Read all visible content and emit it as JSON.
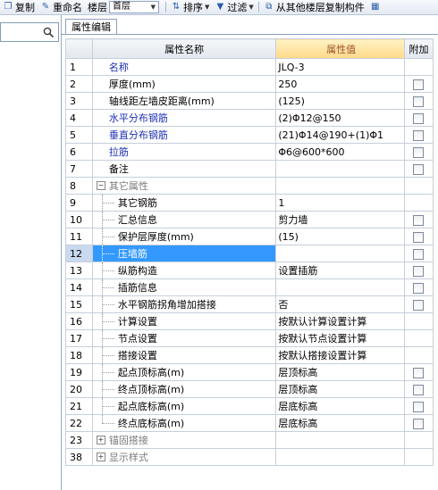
{
  "toolbar": {
    "copy_label": "复制",
    "rename_label": "重命名",
    "floor_label": "楼层",
    "floor_value": "首层",
    "sort_label": "排序",
    "filter_label": "过滤",
    "copy_from_floor_label": "从其他楼层复制构件"
  },
  "tab": {
    "label": "属性编辑"
  },
  "grid": {
    "header": {
      "name": "属性名称",
      "value": "属性值",
      "extra": "附加"
    },
    "rows": [
      {
        "num": "1",
        "name": "名称",
        "value": "JLQ-3",
        "style": "blue",
        "indent": 0,
        "check": false
      },
      {
        "num": "2",
        "name": "厚度(mm)",
        "value": "250",
        "style": "plain",
        "indent": 0,
        "check": true
      },
      {
        "num": "3",
        "name": "轴线距左墙皮距离(mm)",
        "value": "(125)",
        "style": "plain",
        "indent": 0,
        "check": true
      },
      {
        "num": "4",
        "name": "水平分布钢筋",
        "value": "(2)Φ12@150",
        "style": "blue",
        "indent": 0,
        "check": true
      },
      {
        "num": "5",
        "name": "垂直分布钢筋",
        "value": "(21)Φ14@190+(1)Φ1",
        "style": "blue",
        "indent": 0,
        "check": true
      },
      {
        "num": "6",
        "name": "拉筋",
        "value": "Φ6@600*600",
        "style": "blue",
        "indent": 0,
        "check": true
      },
      {
        "num": "7",
        "name": "备注",
        "value": "",
        "style": "plain",
        "indent": 0,
        "check": true
      },
      {
        "num": "8",
        "name": "其它属性",
        "value": "",
        "style": "group-open",
        "indent": 0,
        "check": false
      },
      {
        "num": "9",
        "name": "其它钢筋",
        "value": "1",
        "style": "child",
        "indent": 1,
        "check": false
      },
      {
        "num": "10",
        "name": "汇总信息",
        "value": "剪力墙",
        "style": "child",
        "indent": 1,
        "check": true
      },
      {
        "num": "11",
        "name": "保护层厚度(mm)",
        "value": "(15)",
        "style": "child",
        "indent": 1,
        "check": true
      },
      {
        "num": "12",
        "name": "压墙筋",
        "value": "",
        "style": "child-selected",
        "indent": 1,
        "check": true
      },
      {
        "num": "13",
        "name": "纵筋构造",
        "value": "设置插筋",
        "style": "child",
        "indent": 1,
        "check": true
      },
      {
        "num": "14",
        "name": "插筋信息",
        "value": "",
        "style": "child",
        "indent": 1,
        "check": true
      },
      {
        "num": "15",
        "name": "水平钢筋拐角增加搭接",
        "value": "否",
        "style": "child",
        "indent": 1,
        "check": true
      },
      {
        "num": "16",
        "name": "计算设置",
        "value": "按默认计算设置计算",
        "style": "child",
        "indent": 1,
        "check": false
      },
      {
        "num": "17",
        "name": "节点设置",
        "value": "按默认节点设置计算",
        "style": "child",
        "indent": 1,
        "check": false
      },
      {
        "num": "18",
        "name": "搭接设置",
        "value": "按默认搭接设置计算",
        "style": "child",
        "indent": 1,
        "check": false
      },
      {
        "num": "19",
        "name": "起点顶标高(m)",
        "value": "层顶标高",
        "style": "child",
        "indent": 1,
        "check": true
      },
      {
        "num": "20",
        "name": "终点顶标高(m)",
        "value": "层顶标高",
        "style": "child",
        "indent": 1,
        "check": true
      },
      {
        "num": "21",
        "name": "起点底标高(m)",
        "value": "层底标高",
        "style": "child",
        "indent": 1,
        "check": true
      },
      {
        "num": "22",
        "name": "终点底标高(m)",
        "value": "层底标高",
        "style": "child-last",
        "indent": 1,
        "check": true
      },
      {
        "num": "23",
        "name": "锚固搭接",
        "value": "",
        "style": "group-closed",
        "indent": 0,
        "check": false
      },
      {
        "num": "38",
        "name": "显示样式",
        "value": "",
        "style": "group-closed",
        "indent": 0,
        "check": false
      }
    ]
  }
}
